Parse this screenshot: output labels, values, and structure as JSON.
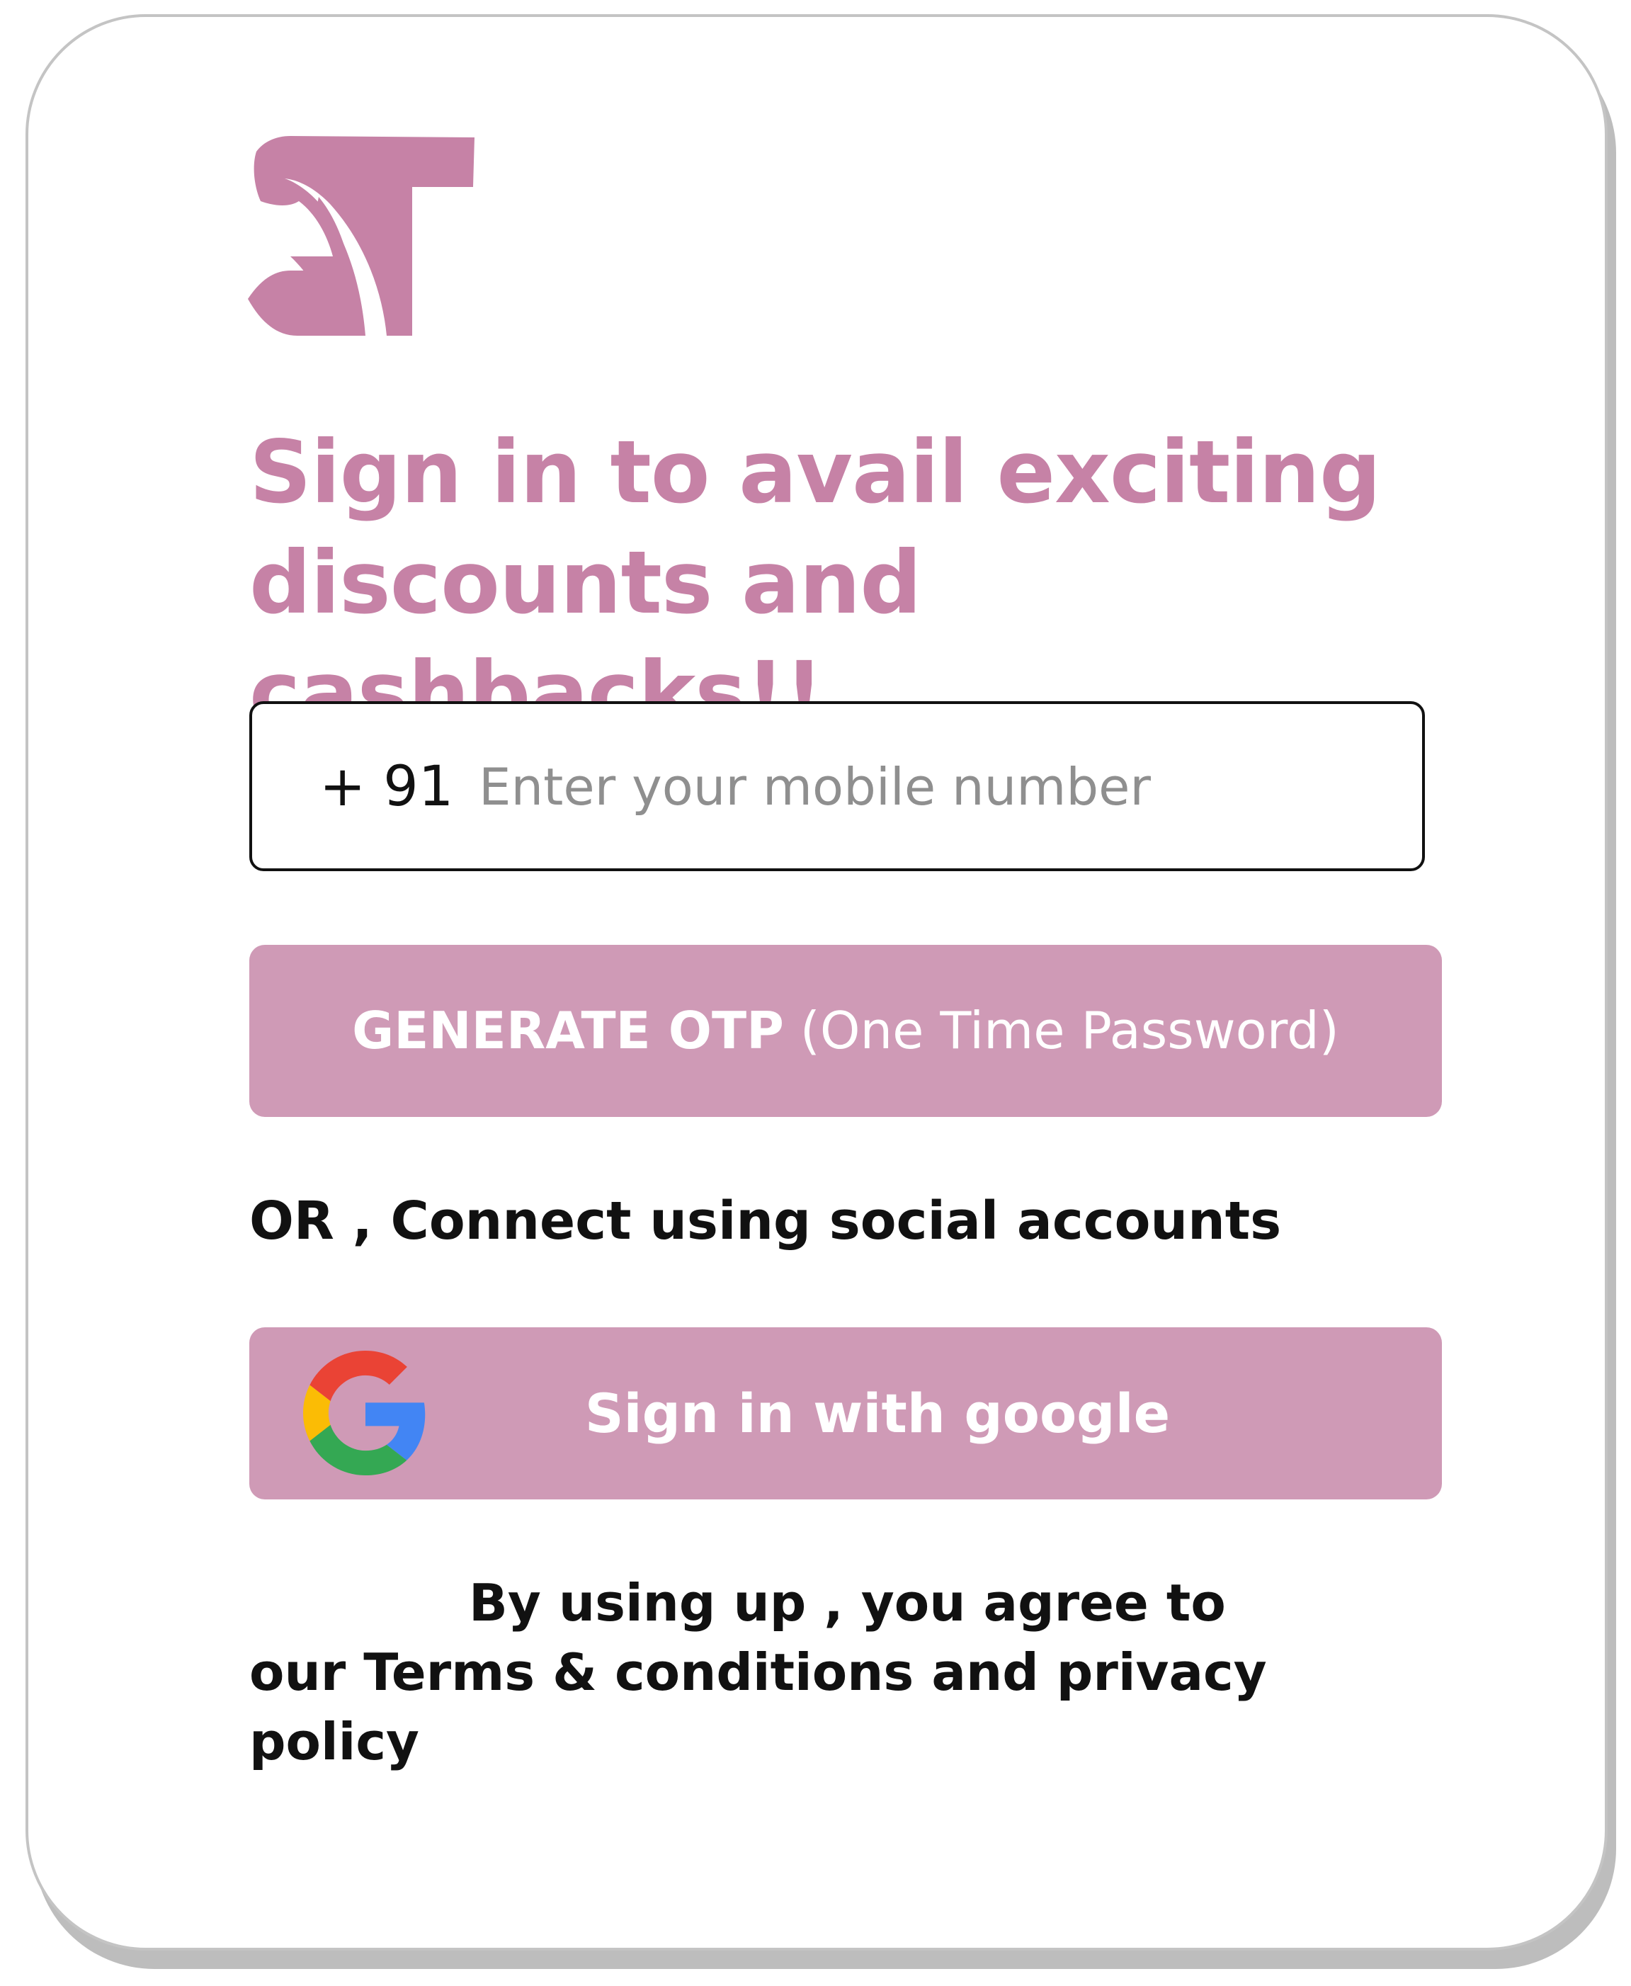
{
  "logo": {
    "text": "ST",
    "color": "#c682a6"
  },
  "headline": {
    "line1": "Sign in to avail exciting",
    "line2": "discounts and cashbacks!!",
    "color": "#c682a6"
  },
  "phone": {
    "prefix": "+ 91",
    "placeholder": "Enter your mobile number",
    "value": ""
  },
  "otp_button": {
    "label_strong": "GENERATE OTP",
    "label_light": "(One Time Password)",
    "background": "#cf9ab6"
  },
  "social": {
    "divider_text": "OR , Connect using social accounts",
    "google_label": "Sign in with google",
    "google_icon": "google-g-icon"
  },
  "terms": {
    "line1": "By using up , you agree to",
    "line2": "our Terms & conditions and privacy policy"
  }
}
